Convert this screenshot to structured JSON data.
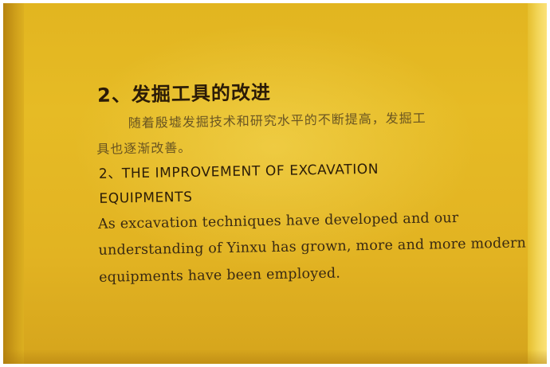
{
  "plaque": {
    "cn_title": "2、发掘工具的改进",
    "cn_body_line1": "随着殷墟发掘技术和研究水平的不断提高，发掘工",
    "cn_body_line2": "具也逐渐改善。",
    "en_title_line1": "2、THE IMPROVEMENT OF EXCAVATION",
    "en_title_line2": "EQUIPMENTS",
    "en_body_line1": "As excavation techniques have developed and our",
    "en_body_line2": "understanding of Yinxu has grown, more and more modern",
    "en_body_line3": "equipments have been employed."
  },
  "colors": {
    "plaque_gold": "#e2b520",
    "text": "#2b1b07"
  }
}
